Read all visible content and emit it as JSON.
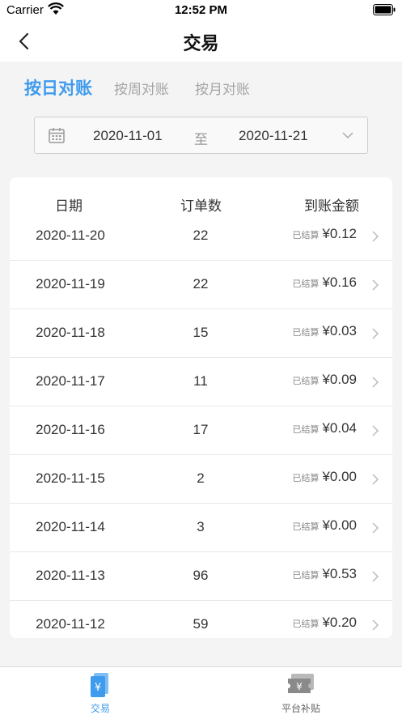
{
  "status_bar": {
    "carrier": "Carrier",
    "time": "12:52 PM"
  },
  "nav": {
    "title": "交易"
  },
  "tabs": [
    {
      "label": "按日对账",
      "active": true
    },
    {
      "label": "按周对账",
      "active": false
    },
    {
      "label": "按月对账",
      "active": false
    }
  ],
  "date_range": {
    "start": "2020-11-01",
    "separator": "至",
    "end": "2020-11-21"
  },
  "table": {
    "headers": [
      "日期",
      "订单数",
      "到账金额"
    ],
    "rows": [
      {
        "date": "2020-11-20",
        "orders": "22",
        "status": "已结算",
        "amount": "¥0.12"
      },
      {
        "date": "2020-11-19",
        "orders": "22",
        "status": "已结算",
        "amount": "¥0.16"
      },
      {
        "date": "2020-11-18",
        "orders": "15",
        "status": "已结算",
        "amount": "¥0.03"
      },
      {
        "date": "2020-11-17",
        "orders": "11",
        "status": "已结算",
        "amount": "¥0.09"
      },
      {
        "date": "2020-11-16",
        "orders": "17",
        "status": "已结算",
        "amount": "¥0.04"
      },
      {
        "date": "2020-11-15",
        "orders": "2",
        "status": "已结算",
        "amount": "¥0.00"
      },
      {
        "date": "2020-11-14",
        "orders": "3",
        "status": "已结算",
        "amount": "¥0.00"
      },
      {
        "date": "2020-11-13",
        "orders": "96",
        "status": "已结算",
        "amount": "¥0.53"
      },
      {
        "date": "2020-11-12",
        "orders": "59",
        "status": "已结算",
        "amount": "¥0.20"
      }
    ]
  },
  "tabbar": [
    {
      "label": "交易",
      "icon": "wallet-yuan-icon",
      "active": true
    },
    {
      "label": "平台补贴",
      "icon": "ticket-yuan-icon",
      "active": false
    }
  ],
  "colors": {
    "accent": "#3e9bee",
    "inactive": "#a5a5a5",
    "background": "#f4f4f4"
  }
}
